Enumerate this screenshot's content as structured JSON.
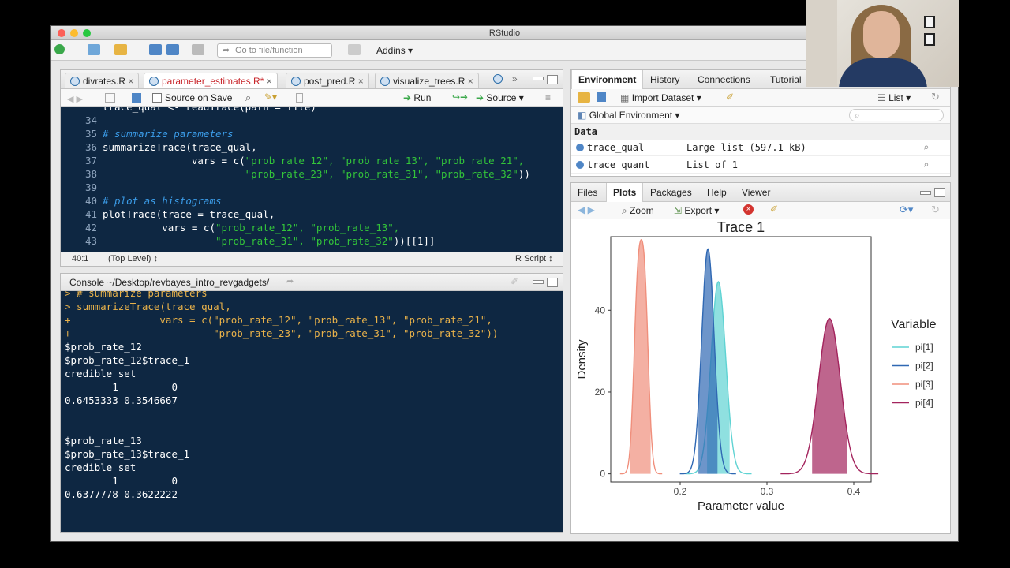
{
  "window": {
    "title": "RStudio"
  },
  "toolbar": {
    "goto_placeholder": "Go to file/function",
    "addins_label": "Addins"
  },
  "editor": {
    "tabs": [
      {
        "label": "divrates.R"
      },
      {
        "label": "parameter_estimates.R*"
      },
      {
        "label": "post_pred.R"
      },
      {
        "label": "visualize_trees.R"
      }
    ],
    "source_on_save": "Source on Save",
    "run_label": "Run",
    "source_label": "Source",
    "lines": [
      {
        "num": "",
        "code": "trace_qual <- readTrace(path = file)"
      },
      {
        "num": "34",
        "code": ""
      },
      {
        "num": "35",
        "code": "# summarize parameters"
      },
      {
        "num": "36",
        "code": "summarizeTrace(trace_qual,"
      },
      {
        "num": "37",
        "code_pre": "               vars = c(",
        "code_str": "\"prob_rate_12\", \"prob_rate_13\", \"prob_rate_21\","
      },
      {
        "num": "38",
        "code_pre": "                        ",
        "code_str": "\"prob_rate_23\", \"prob_rate_31\", \"prob_rate_32\"",
        "code_post": "))"
      },
      {
        "num": "39",
        "code": ""
      },
      {
        "num": "40",
        "code": "# plot as histograms"
      },
      {
        "num": "41",
        "code": "plotTrace(trace = trace_qual,"
      },
      {
        "num": "42",
        "code_pre": "          vars = c(",
        "code_str": "\"prob_rate_12\", \"prob_rate_13\","
      },
      {
        "num": "43",
        "code_pre": "                   ",
        "code_str": "\"prob_rate_31\", \"prob_rate_32\"",
        "code_post": "))[[1]]"
      }
    ],
    "status_pos": "40:1",
    "status_level": "(Top Level) ↕",
    "status_type": "R Script ↕"
  },
  "console": {
    "title": "Console ~/Desktop/revbayes_intro_revgadgets/",
    "lines": [
      {
        "text": "> # summarize parameters",
        "cls": "cmd"
      },
      {
        "text": "> summarizeTrace(trace_qual,",
        "cls": "cmd"
      },
      {
        "text": "+               vars = c(\"prob_rate_12\", \"prob_rate_13\", \"prob_rate_21\",",
        "cls": "cmd"
      },
      {
        "text": "+                        \"prob_rate_23\", \"prob_rate_31\", \"prob_rate_32\"))",
        "cls": "cmd"
      },
      {
        "text": "$prob_rate_12",
        "cls": ""
      },
      {
        "text": "$prob_rate_12$trace_1",
        "cls": ""
      },
      {
        "text": "credible_set",
        "cls": ""
      },
      {
        "text": "        1         0",
        "cls": ""
      },
      {
        "text": "0.6453333 0.3546667",
        "cls": ""
      },
      {
        "text": "",
        "cls": ""
      },
      {
        "text": "",
        "cls": ""
      },
      {
        "text": "$prob_rate_13",
        "cls": ""
      },
      {
        "text": "$prob_rate_13$trace_1",
        "cls": ""
      },
      {
        "text": "credible_set",
        "cls": ""
      },
      {
        "text": "        1         0",
        "cls": ""
      },
      {
        "text": "0.6377778 0.3622222",
        "cls": ""
      }
    ]
  },
  "env": {
    "tabs": [
      "Environment",
      "History",
      "Connections",
      "Tutorial"
    ],
    "import_label": "Import Dataset",
    "list_label": "List",
    "global_env": "Global Environment",
    "section": "Data",
    "rows": [
      {
        "name": "trace_qual",
        "value": "Large list (597.1 kB)"
      },
      {
        "name": "trace_quant",
        "value": "List of 1"
      }
    ]
  },
  "files": {
    "tabs": [
      "Files",
      "Plots",
      "Packages",
      "Help",
      "Viewer"
    ],
    "zoom_label": "Zoom",
    "export_label": "Export"
  },
  "chart_data": {
    "type": "area",
    "title": "Trace 1",
    "xlabel": "Parameter value",
    "ylabel": "Density",
    "xlim": [
      0.12,
      0.42
    ],
    "ylim": [
      -2,
      58
    ],
    "xticks": [
      0.2,
      0.3,
      0.4
    ],
    "xtick_labels": [
      "0.2",
      "0.3",
      "0.4"
    ],
    "yticks": [
      0,
      20,
      40
    ],
    "legend_title": "Variable",
    "legend_position": "right",
    "series": [
      {
        "name": "pi[1]",
        "color": "#5fd3d3",
        "peaks": [
          {
            "mu": 0.244,
            "sigma": 0.0085,
            "h": 47
          }
        ],
        "hdi": [
          0.231,
          0.257
        ]
      },
      {
        "name": "pi[2]",
        "color": "#2f68b3",
        "peaks": [
          {
            "mu": 0.232,
            "sigma": 0.0072,
            "h": 55
          }
        ],
        "hdi": [
          0.221,
          0.243
        ]
      },
      {
        "name": "pi[3]",
        "color": "#f08f7c",
        "peaks": [
          {
            "mu": 0.151,
            "sigma": 0.0045,
            "h": 42
          },
          {
            "mu": 0.159,
            "sigma": 0.0045,
            "h": 43
          }
        ],
        "hdi": [
          0.142,
          0.166
        ]
      },
      {
        "name": "pi[4]",
        "color": "#a3245d",
        "peaks": [
          {
            "mu": 0.372,
            "sigma": 0.0125,
            "h": 38
          }
        ],
        "hdi": [
          0.352,
          0.392
        ]
      }
    ]
  }
}
